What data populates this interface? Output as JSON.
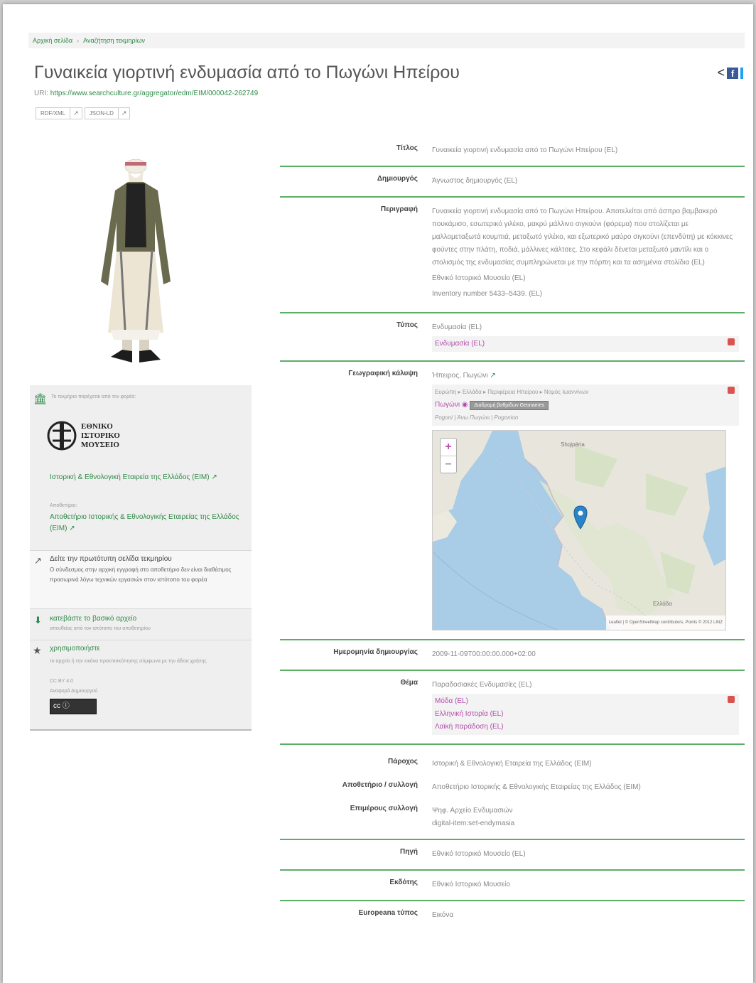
{
  "breadcrumb": {
    "home": "Αρχική σελίδα",
    "current": "Αναζήτηση τεκμηρίων"
  },
  "title": "Γυναικεία γιορτινή ενδυμασία από το Πωγώνι Ηπείρου",
  "uri": {
    "label": "URI:",
    "value": "https://www.searchculture.gr/aggregator/edm/EIM/000042-262749"
  },
  "formats": [
    "RDF/XML",
    "JSON-LD"
  ],
  "provider": {
    "intro": "Το τεκμήριο παρέχεται από τον φορέα:",
    "logo_text": [
      "ΕΘΝΙΚΟ",
      "ΙΣΤΟΡΙΚΟ",
      "ΜΟΥΣΕΙΟ"
    ],
    "org": "Ιστορική & Εθνολογική Εταιρεία της Ελλάδος (ΕΙΜ)",
    "repo_label": "Αποθετήριο:",
    "repo": "Αποθετήριο Ιστορικής & Εθνολογικής Εταιρείας της Ελλάδος (ΕΙΜ)",
    "original_title": "Δείτε την πρωτότυπη σελίδα τεκμηρίου",
    "original_text": "Ο σύνδεσμος στην αρχική εγγραφή στο αποθετήριο δεν είναι διαθέσιμος προσωρινά λόγω τεχνικών εργασιών στον ιστότοπο του φορέα",
    "download_title": "κατεβάστε το βασικό αρχείο",
    "download_text": "απευθείας από τον ιστότοπο του αποθετηρίου",
    "rights_title": "χρησιμοποιήστε",
    "rights_text": "το αρχείο ή την εικόνα προεπισκόπησης σύμφωνα με την άδεια χρήσης",
    "rights_license": "CC BY 4.0",
    "rights_extra": "Αναφορά Δημιουργού",
    "license_badge": "cc  ⓘ"
  },
  "metadata": {
    "title_label": "Τίτλος",
    "title_value": "Γυναικεία γιορτινή ενδυμασία από το Πωγώνι Ηπείρου (EL)",
    "creator_label": "Δημιουργός",
    "creator_value": "Άγνωστος δημιουργός (EL)",
    "desc_label": "Περιγραφή",
    "desc_value": "Γυναικεία γιορτινή ενδυμασία από το Πωγώνι Ηπείρου. Αποτελείται από άσπρο βαμβακερό πουκάμισο, εσωτερικό γιλέκο, μακρύ μάλλινο σιγκούνι (φόρεμα) που στολίζεται με μαλλομεταξωτά κουμπιά, μεταξωτό γιλέκο, και εξωτερικό μαύρο σιγκούνι (επενδύτη) με κόκκινες φούντες στην πλάτη, ποδιά, μάλλινες κάλτσες. Στο κεφάλι δένεται μεταξωτό μαντίλι και ο στολισμός της ενδυμασίας συμπληρώνεται με την πόρπη και τα ασημένια στολίδια (EL)",
    "desc_source": "Εθνικό Ιστορικό Μουσείο (EL)",
    "desc_inventory": "Inventory number 5433–5439. (EL)",
    "type_label": "Τύπος",
    "type_value": "Ενδυμασία (EL)",
    "type_link": "Ενδυμασία (EL)",
    "geo_label": "Γεωγραφική κάλυψη",
    "geo_value": "Ήπειρος, Πωγώνι",
    "geo_path": "Ευρώπη ▸ Ελλάδα ▸ Περιφέρεια Ηπείρου ▸ Νομός Ιωαννίνων",
    "geo_link": "Πωγώνι",
    "geo_box": "Διαδρομή βαθμίδων Geonames",
    "geo_alt": "Pogoni | Άνω Πωγώνι | Pogonion",
    "map_attribution": "Leaflet | © OpenStreetMap contributors, Points © 2012 LINZ",
    "map_labels": [
      "Shqipëria",
      "Ελλάδα"
    ],
    "date_label": "Ημερομηνία δημιουργίας",
    "date_value": "2009-11-09T00:00:00.000+02:00",
    "subject_label": "Θέμα",
    "subject_value": "Παραδοσιακές Ενδυμασίες (EL)",
    "subject_links": [
      "Μόδα (EL)",
      "Ελληνική Ιστορία (EL)",
      "Λαϊκή παράδοση (EL)"
    ],
    "provider_label": "Πάροχος",
    "provider_value": "Ιστορική & Εθνολογική Εταιρεία της Ελλάδος (ΕΙΜ)",
    "repo_label": "Αποθετήριο / συλλογή",
    "repo_value": "Αποθετήριο Ιστορικής & Εθνολογικής Εταιρείας της Ελλάδος (ΕΙΜ)",
    "collection_label": "Επιμέρους συλλογή",
    "collection_value1": "Ψηφ. Αρχείο Ενδυμασιών",
    "collection_value2": "digital-item:set-endymasia",
    "source_label": "Πηγή",
    "source_value": "Εθνικό Ιστορικό Μουσείο (EL)",
    "publisher_label": "Εκδότης",
    "publisher_value": "Εθνικό Ιστορικό Μουσείο",
    "eu_type_label": "Europeana τύπος",
    "eu_type_value": "Εικόνα"
  }
}
